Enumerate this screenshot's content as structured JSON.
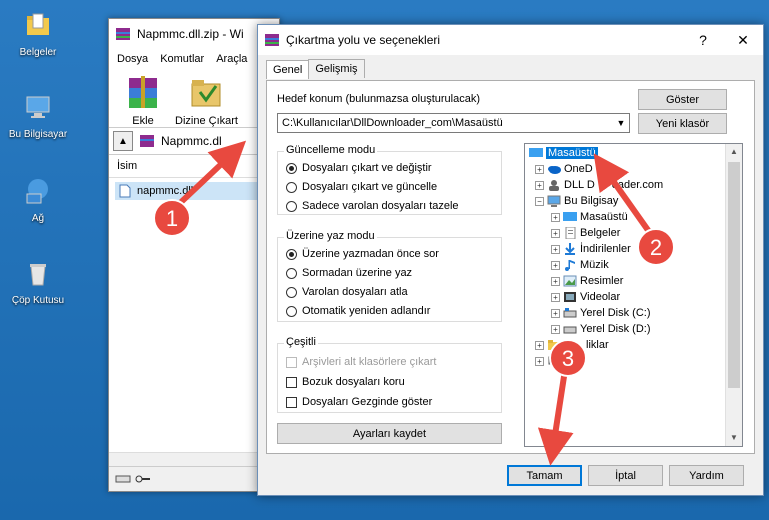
{
  "desktop": {
    "icons": [
      {
        "label": "Belgeler",
        "icon": "folder-icon"
      },
      {
        "label": "Bu Bilgisayar",
        "icon": "computer-icon"
      },
      {
        "label": "Ağ",
        "icon": "network-icon"
      },
      {
        "label": "Çöp Kutusu",
        "icon": "recycle-bin-icon"
      }
    ]
  },
  "winrar": {
    "title": "Napmmc.dll.zip - Wi",
    "menu": [
      "Dosya",
      "Komutlar",
      "Araçla"
    ],
    "tools": [
      {
        "label": "Ekle"
      },
      {
        "label": "Dizine Çıkart"
      }
    ],
    "path": "Napmmc.dl",
    "column": "İsim",
    "file": "napmmc.dll"
  },
  "dialog": {
    "title": "Çıkartma yolu ve seçenekleri",
    "help": "?",
    "close": "✕",
    "tabs": [
      "Genel",
      "Gelişmiş"
    ],
    "dest_label": "Hedef konum (bulunmazsa oluşturulacak)",
    "dest_value": "C:\\Kullanıcılar\\DllDownloader_com\\Masaüstü",
    "show_button": "Göster",
    "new_folder_button": "Yeni klasör",
    "update_mode": {
      "title": "Güncelleme modu",
      "options": [
        "Dosyaları çıkart ve değiştir",
        "Dosyaları çıkart ve güncelle",
        "Sadece varolan dosyaları tazele"
      ],
      "selected": 0
    },
    "overwrite_mode": {
      "title": "Üzerine yaz modu",
      "options": [
        "Üzerine yazmadan önce sor",
        "Sormadan üzerine yaz",
        "Varolan dosyaları atla",
        "Otomatik yeniden adlandır"
      ],
      "selected": 0
    },
    "misc": {
      "title": "Çeşitli",
      "options": [
        {
          "label": "Arşivleri alt klasörlere çıkart",
          "disabled": true
        },
        {
          "label": "Bozuk dosyaları koru",
          "disabled": false
        },
        {
          "label": "Dosyaları Gezginde göster",
          "disabled": false
        }
      ]
    },
    "save_settings": "Ayarları kaydet",
    "tree": [
      {
        "label": "Masaüstü",
        "icon": "desktop-icon",
        "selected": true
      },
      {
        "label": "OneD",
        "icon": "onedrive-icon"
      },
      {
        "label": "DLL D",
        "suffix": "oader.com",
        "icon": "user-icon"
      },
      {
        "label": "Bu Bilgisay",
        "icon": "computer-icon"
      },
      {
        "label": "Masaüstü",
        "icon": "desktop-icon"
      },
      {
        "label": "Belgeler",
        "icon": "document-icon"
      },
      {
        "label": "İndirilenler",
        "icon": "download-icon"
      },
      {
        "label": "Müzik",
        "icon": "music-icon"
      },
      {
        "label": "Resimler",
        "icon": "picture-icon"
      },
      {
        "label": "Videolar",
        "icon": "video-icon"
      },
      {
        "label": "Yerel Disk (C:)",
        "icon": "disk-icon"
      },
      {
        "label": "Yerel Disk (D:)",
        "icon": "disk-icon"
      },
      {
        "label": "liklar",
        "icon": "folder-icon"
      },
      {
        "label": "",
        "icon": "network-icon"
      }
    ],
    "ok": "Tamam",
    "cancel": "İptal",
    "help_button": "Yardım"
  },
  "annotations": [
    {
      "number": "1"
    },
    {
      "number": "2"
    },
    {
      "number": "3"
    }
  ],
  "colors": {
    "accent": "#0078d7",
    "annotation": "#e8493f"
  }
}
